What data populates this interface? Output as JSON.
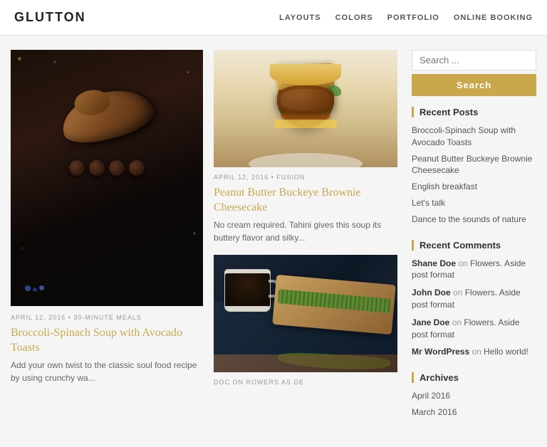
{
  "header": {
    "logo": "GLUTTON",
    "nav": [
      {
        "label": "LAYOUTS",
        "href": "#"
      },
      {
        "label": "COLORS",
        "href": "#"
      },
      {
        "label": "PORTFOLIO",
        "href": "#"
      },
      {
        "label": "ONLINE BOOKING",
        "href": "#"
      }
    ]
  },
  "featured_post": {
    "date": "APRIL 12, 2016",
    "category": "30-MINUTE MEALS",
    "title": "Broccoli-Spinach Soup with Avocado Toasts",
    "excerpt": "Add your own twist to the classic soul food recipe by using crunchy wa...",
    "title_color": "#c9a84c"
  },
  "main_posts": [
    {
      "date": "APRIL 12, 2016",
      "category": "FUSION",
      "title": "Peanut Butter Buckeye Brownie Cheesecake",
      "excerpt": "No cream required. Tahini gives this soup its buttery flavor and silky...",
      "title_color": "#c9a84c"
    }
  ],
  "sidebar": {
    "search": {
      "placeholder": "Search ...",
      "button_label": "Search"
    },
    "recent_posts": {
      "title": "Recent Posts",
      "items": [
        "Broccoli-Spinach Soup with Avocado Toasts",
        "Peanut Butter Buckeye Brownie Cheesecake",
        "English breakfast",
        "Let's talk",
        "Dance to the sounds of nature"
      ]
    },
    "recent_comments": {
      "title": "Recent Comments",
      "items": [
        {
          "author": "Shane Doe",
          "action": "on",
          "text": "Flowers. Aside post format"
        },
        {
          "author": "John Doe",
          "action": "on",
          "text": "Flowers. Aside post format"
        },
        {
          "author": "Jane Doe",
          "action": "on",
          "text": "Flowers. Aside post format"
        },
        {
          "author": "Mr WordPress",
          "action": "on",
          "text": "Hello world!"
        }
      ]
    },
    "archives": {
      "title": "Archives",
      "items": [
        "April 2016",
        "March 2016"
      ]
    }
  },
  "second_post_meta": {
    "date": "Doc on Rowers As de"
  }
}
